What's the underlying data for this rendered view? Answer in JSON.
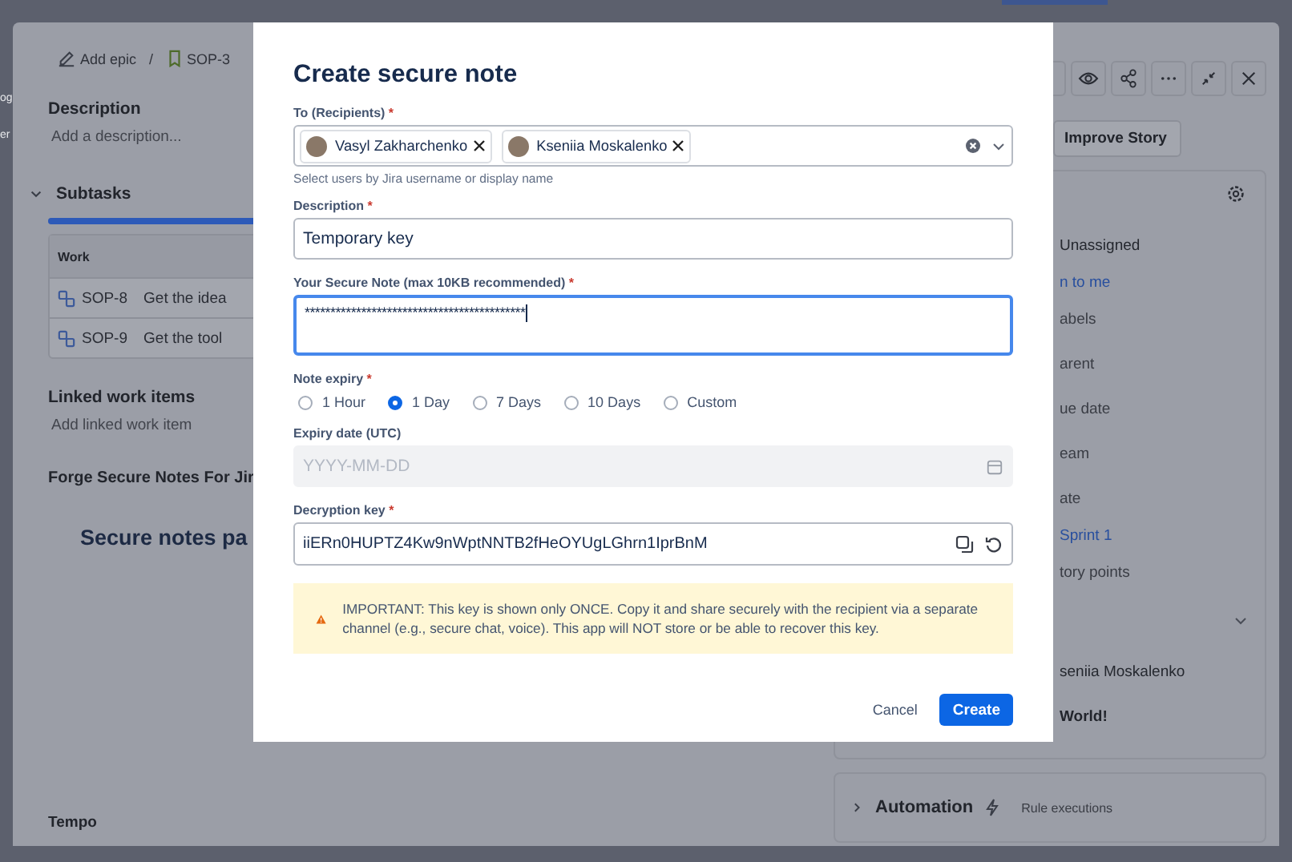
{
  "background": {
    "left_edge": [
      "og",
      "er"
    ],
    "breadcrumb": {
      "epic": "Add epic",
      "separator": "/",
      "issue": "SOP-3"
    },
    "description": {
      "heading": "Description",
      "placeholder": "Add a description..."
    },
    "subtasks": {
      "heading": "Subtasks",
      "expanded": true,
      "level": 1,
      "column": "Work",
      "rows": [
        {
          "key": "SOP-8",
          "summary": "Get the idea"
        },
        {
          "key": "SOP-9",
          "summary": "Get the tool"
        }
      ]
    },
    "linked": {
      "heading": "Linked work items",
      "placeholder": "Add linked work item"
    },
    "forge_heading": "Forge Secure Notes For Jir",
    "forge_title": "Secure notes pa",
    "tempo": "Tempo",
    "improve_button": "Improve Story",
    "fields": [
      {
        "text": "Unassigned",
        "kind": "value"
      },
      {
        "text": "n to me",
        "kind": "link"
      },
      {
        "text": "abels",
        "kind": "label"
      },
      {
        "text": "arent",
        "kind": "label"
      },
      {
        "text": "ue date",
        "kind": "label"
      },
      {
        "text": "eam",
        "kind": "label"
      },
      {
        "text": "ate",
        "kind": "label"
      },
      {
        "text": "Sprint 1",
        "kind": "link"
      },
      {
        "text": "tory points",
        "kind": "label"
      },
      {
        "kind": "chevron"
      },
      {
        "text": "seniia Moskalenko",
        "kind": "value"
      },
      {
        "text": "World!",
        "kind": "bold"
      }
    ],
    "automation": {
      "title": "Automation",
      "subtitle": "Rule executions"
    }
  },
  "modal": {
    "title": "Create secure note",
    "recipients": {
      "label": "To (Recipients)",
      "mark": "*",
      "chips": [
        "Vasyl Zakharchenko",
        "Kseniia Moskalenko"
      ],
      "helper": "Select users by Jira username or display name"
    },
    "description": {
      "label": "Description",
      "mark": "*",
      "value": "Temporary key"
    },
    "note": {
      "label": "Your Secure Note (max 10KB recommended)",
      "mark": "*",
      "value": "*******************************************",
      "focused": true
    },
    "expiry": {
      "label": "Note expiry",
      "mark": "*",
      "options": [
        {
          "label": "1 Hour",
          "selected": false
        },
        {
          "label": "1 Day",
          "selected": true
        },
        {
          "label": "7 Days",
          "selected": false
        },
        {
          "label": "10 Days",
          "selected": false
        },
        {
          "label": "Custom",
          "selected": false
        }
      ]
    },
    "expiry_date": {
      "label": "Expiry date (UTC)",
      "placeholder": "YYYY-MM-DD",
      "disabled": true
    },
    "key": {
      "label": "Decryption key",
      "mark": "*",
      "value": "iiERn0HUPTZ4Kw9nWptNNTB2fHeOYUgLGhrn1IprBnM"
    },
    "warning": "IMPORTANT: This key is shown only ONCE. Copy it and share securely with the recipient via a separate channel (e.g., secure chat, voice). This app will NOT store or be able to recover this key.",
    "cancel": "Cancel",
    "create": "Create"
  }
}
